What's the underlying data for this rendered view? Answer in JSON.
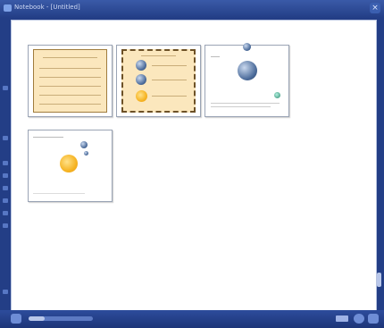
{
  "window": {
    "title": "Notebook - [Untitled]",
    "close_label": "×"
  },
  "status": {
    "zoom_fraction": 0.25
  },
  "pages": [
    {
      "style": "parchment-lined"
    },
    {
      "style": "parchment-list"
    },
    {
      "style": "globe"
    },
    {
      "style": "sun"
    }
  ]
}
